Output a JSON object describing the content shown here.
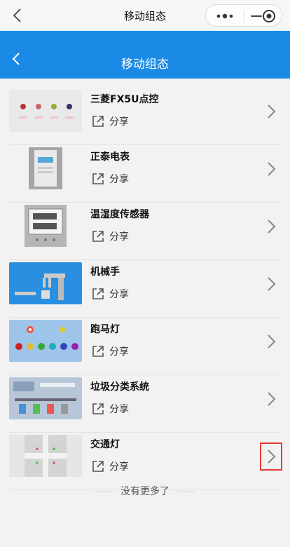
{
  "wechat": {
    "title": "移动组态",
    "back_icon": "chevron-left-icon",
    "more_icon": "dots-icon",
    "minimize_icon": "minus-icon",
    "close_icon": "target-icon"
  },
  "header": {
    "title": "移动组态",
    "bg_color": "#1a8ae6"
  },
  "items": [
    {
      "name": "三菱FX5U点控",
      "share": "分享",
      "thumb": "lights-thumb"
    },
    {
      "name": "正泰电表",
      "share": "分享",
      "thumb": "meter-thumb"
    },
    {
      "name": "温湿度传感器",
      "share": "分享",
      "thumb": "sensor-thumb"
    },
    {
      "name": "机械手",
      "share": "分享",
      "thumb": "robot-arm-thumb"
    },
    {
      "name": "跑马灯",
      "share": "分享",
      "thumb": "marquee-thumb"
    },
    {
      "name": "垃圾分类系统",
      "share": "分享",
      "thumb": "waste-system-thumb"
    },
    {
      "name": "交通灯",
      "share": "分享",
      "thumb": "traffic-light-thumb"
    }
  ],
  "footer": {
    "text": "没有更多了"
  }
}
